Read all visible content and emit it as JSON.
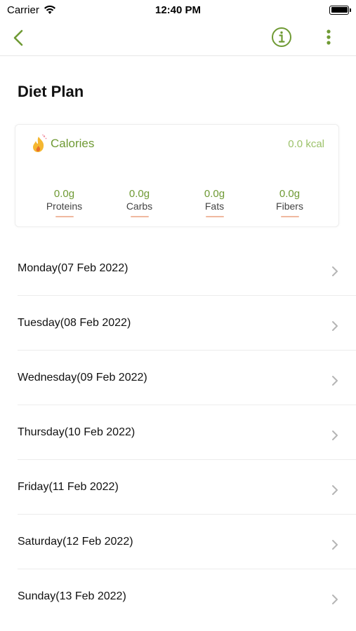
{
  "status_bar": {
    "carrier": "Carrier",
    "time": "12:40 PM"
  },
  "nav": {
    "back_icon": "chevron-left-icon",
    "info_icon": "info-circle-icon",
    "more_icon": "vertical-ellipsis-icon"
  },
  "page": {
    "title": "Diet Plan"
  },
  "summary": {
    "calories_label": "Calories",
    "calories_value": "0.0 kcal",
    "macros": [
      {
        "value": "0.0g",
        "label": "Proteins"
      },
      {
        "value": "0.0g",
        "label": "Carbs"
      },
      {
        "value": "0.0g",
        "label": "Fats"
      },
      {
        "value": "0.0g",
        "label": "Fibers"
      }
    ]
  },
  "days": [
    {
      "label": "Monday(07 Feb 2022)"
    },
    {
      "label": "Tuesday(08 Feb 2022)"
    },
    {
      "label": "Wednesday(09 Feb 2022)"
    },
    {
      "label": "Thursday(10 Feb 2022)"
    },
    {
      "label": "Friday(11 Feb 2022)"
    },
    {
      "label": "Saturday(12 Feb 2022)"
    },
    {
      "label": "Sunday(13 Feb 2022)"
    }
  ],
  "colors": {
    "accent": "#6f9a34",
    "accent_light": "#9cc26a",
    "macro_underline": "#f0b9a0",
    "divider": "#ececec"
  }
}
